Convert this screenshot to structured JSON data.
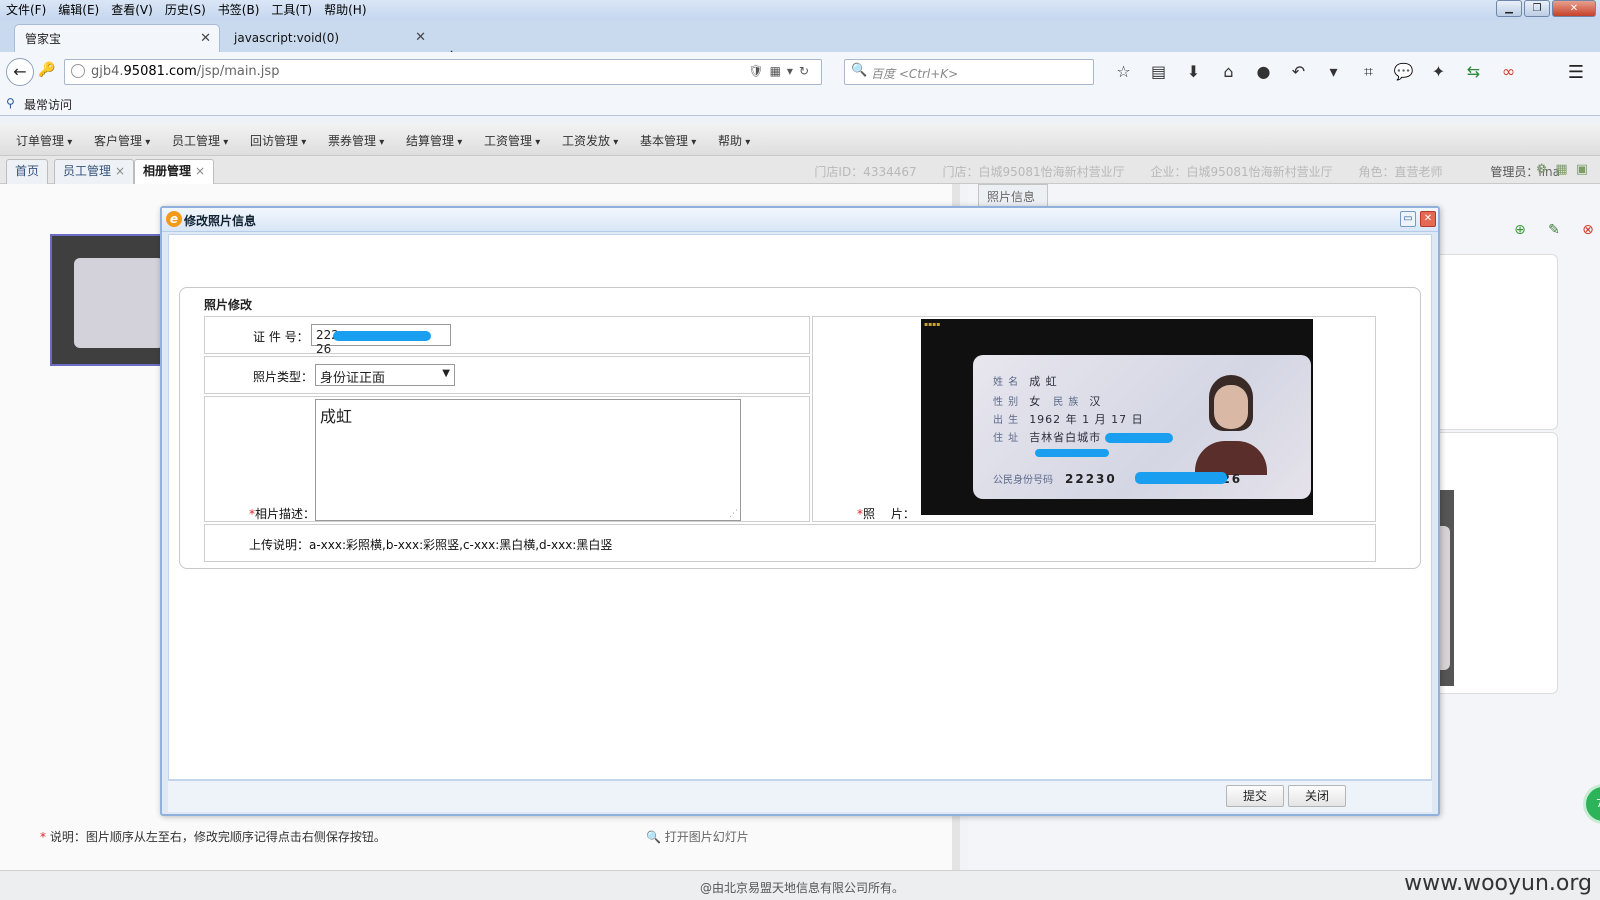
{
  "menubar": [
    "文件(F)",
    "编辑(E)",
    "查看(V)",
    "历史(S)",
    "书签(B)",
    "工具(T)",
    "帮助(H)"
  ],
  "window_controls": {
    "minimize": "▁",
    "restore": "❐",
    "close": "✕"
  },
  "browser_tabs": [
    {
      "label": "管家宝",
      "active": true
    },
    {
      "label": "javascript:void(0)",
      "active": false
    }
  ],
  "new_tab": "+",
  "address": {
    "host_prefix": "gjb4.",
    "host_main": "95081.com",
    "path": "/jsp/main.jsp"
  },
  "search": {
    "placeholder": "百度 <Ctrl+K>"
  },
  "bookmarks": {
    "label": "最常访问"
  },
  "toolbar_icons": [
    "star-icon",
    "reader-icon",
    "download-icon",
    "home-icon",
    "chat-icon",
    "undo-icon",
    "crop-icon",
    "comment-icon",
    "extension-icon",
    "sync-icon",
    "web-icon",
    "menu-icon"
  ],
  "app_menu": [
    "订单管理",
    "客户管理",
    "员工管理",
    "回访管理",
    "票券管理",
    "结算管理",
    "工资管理",
    "工资发放",
    "基本管理",
    "帮助"
  ],
  "app_tabs": [
    {
      "label": "首页",
      "closable": false
    },
    {
      "label": "员工管理",
      "closable": true
    },
    {
      "label": "相册管理",
      "closable": true,
      "selected": true
    }
  ],
  "info": {
    "store_id": "门店ID：4334467",
    "store": "门店：白城95081怡海新村营业厅",
    "company": "企业：白城95081怡海新村营业厅",
    "role": "角色：直营老师",
    "admin_label": "管理员：",
    "admin_name": "lina"
  },
  "left_panel": {
    "notice_star": "*",
    "notice": "说明：图片顺序从左至右，修改完顺序记得点击右侧保存按钮。",
    "slideshow": "打开图片幻灯片"
  },
  "right_panel": {
    "tab": "照片信息"
  },
  "modal": {
    "title": "修改照片信息",
    "section": "照片修改",
    "id_label": "证 件 号：",
    "id_value_start": "222",
    "id_value_end": "26",
    "type_label": "照片类型：",
    "type_value": "身份证正面",
    "desc_star": "*",
    "desc_label": "相片描述：",
    "desc_value": "成虹",
    "photo_star": "*",
    "photo_label": "照　 片：",
    "upload_note": "上传说明：a-xxx:彩照横,b-xxx:彩照竖,c-xxx:黑白横,d-xxx:黑白竖",
    "submit": "提交",
    "close": "关闭"
  },
  "id_card": {
    "name_key": "姓 名",
    "name": "成 虹",
    "sex_key": "性 别",
    "sex": "女",
    "nation_key": "民 族",
    "nation": "汉",
    "birth_key": "出 生",
    "birth": "1962 年 1 月 17 日",
    "addr_key": "住 址",
    "addr": "吉林省白城市",
    "num_key": "公民身份号码",
    "num_start": "22230",
    "num_end": "0026"
  },
  "badge": "74",
  "footer": {
    "copyright": "@由北京易盟天地信息有限公司所有。",
    "watermark": "www.wooyun.org"
  }
}
